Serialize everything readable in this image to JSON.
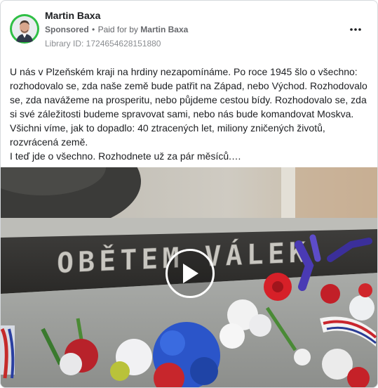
{
  "post": {
    "author": "Martin Baxa",
    "sponsored_label": "Sponsored",
    "paid_for_prefix": "Paid for by",
    "paid_for_name": "Martin Baxa",
    "library_id": "Library ID: 1724654628151880",
    "body_lines": [
      "U nás v Plzeňském kraji na hrdiny nezapomínáme. Po roce 1945 šlo o všechno: rozhodovalo se, zda naše země bude patřit na Západ, nebo Východ. Rozhodovalo se, zda navážeme na prosperitu, nebo půjdeme cestou bídy. Rozhodovalo se, zda si své záležitosti budeme spravovat sami, nebo nás bude komandovat Moskva. Všichni víme, jak to dopadlo: 40 ztracených let, miliony zničených životů, rozvrácená země.",
      "I teď jde o všechno. Rozhodnete už za pár měsíců.…"
    ]
  },
  "video": {
    "memorial_inscription": "OBĚTEM VÁLEK"
  },
  "icons": {
    "more": "more-horizontal-icon",
    "play": "play-icon"
  },
  "colors": {
    "avatar_ring": "#2fbf45",
    "meta_text": "#65676b"
  }
}
